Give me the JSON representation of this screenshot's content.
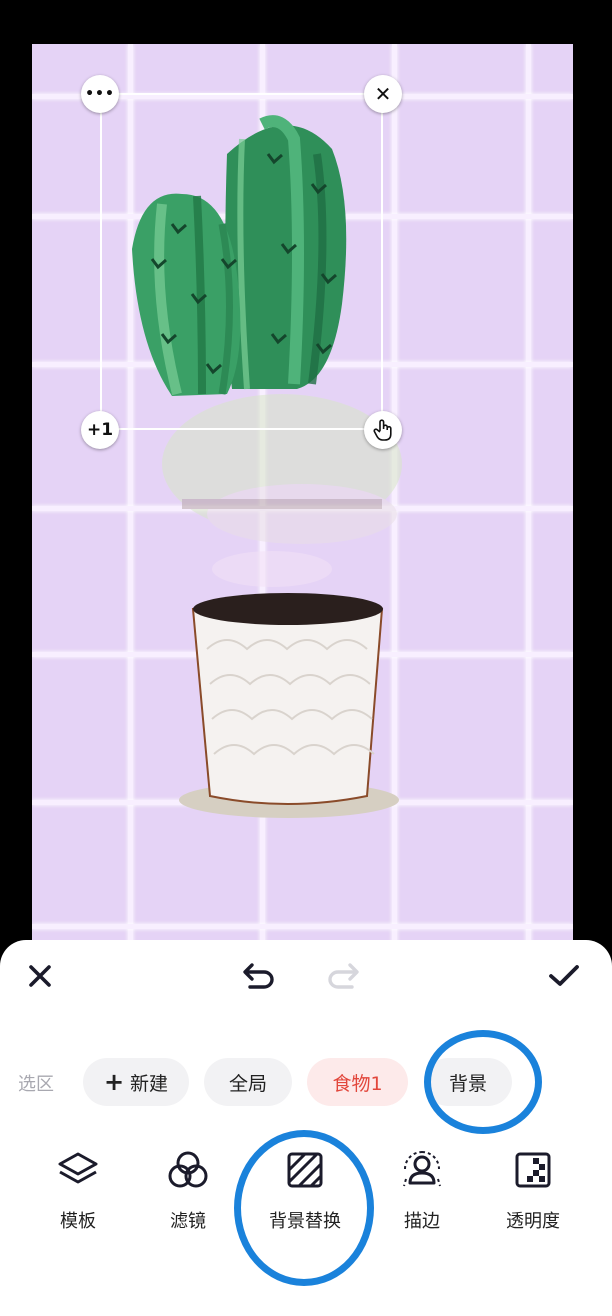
{
  "selection": {
    "more_label": "•••",
    "close_label": "✕",
    "duplicate_label": "+1"
  },
  "toolbar": {
    "cancel_icon": "close-icon",
    "undo_icon": "undo-icon",
    "redo_icon": "redo-icon",
    "confirm_icon": "check-icon"
  },
  "chips": {
    "section_label": "选区",
    "items": [
      {
        "label": "新建",
        "prefix": "+"
      },
      {
        "label": "全局"
      },
      {
        "label": "食物1",
        "active": true
      },
      {
        "label": "背景"
      }
    ]
  },
  "tools": [
    {
      "label": "模板",
      "icon": "layers-icon"
    },
    {
      "label": "滤镜",
      "icon": "filter-circles-icon"
    },
    {
      "label": "背景替换",
      "icon": "background-replace-icon"
    },
    {
      "label": "描边",
      "icon": "outline-person-icon"
    },
    {
      "label": "透明度",
      "icon": "transparency-icon"
    }
  ],
  "colors": {
    "canvas_bg": "#e5d3f6",
    "accent_red": "#e2473c",
    "annotation_blue": "#1a82db"
  }
}
